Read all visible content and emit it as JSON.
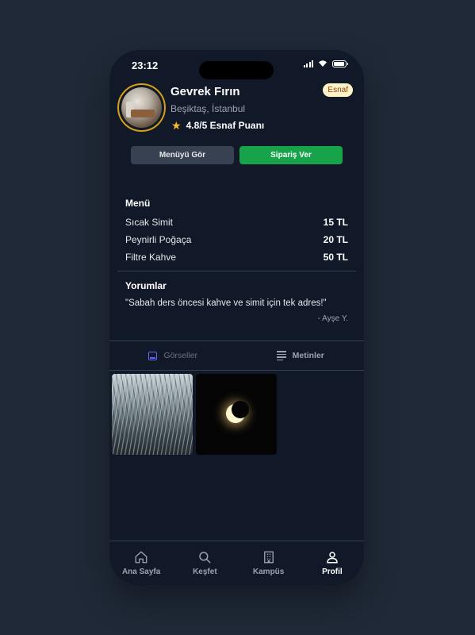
{
  "status": {
    "time": "23:12",
    "battery_level": 0.9
  },
  "shop": {
    "name": "Gevrek Fırın",
    "location": "Beşiktaş, İstanbul",
    "rating": "4.8/5 Esnaf Puanı",
    "badge": "Esnaf"
  },
  "actions": {
    "menu_button": "Menüyü Gör",
    "order_button": "Sipariş Ver"
  },
  "menu": {
    "title": "Menü",
    "items": [
      {
        "name": "Sıcak Simit",
        "price": "15 TL"
      },
      {
        "name": "Peynirli Poğaça",
        "price": "20 TL"
      },
      {
        "name": "Filtre Kahve",
        "price": "50 TL"
      }
    ]
  },
  "reviews": {
    "title": "Yorumlar",
    "quote": "\"Sabah ders öncesi kahve ve simit için tek adres!\"",
    "author": "- Ayşe Y."
  },
  "content_tabs": [
    {
      "label": "Görseller",
      "icon": "image-icon"
    },
    {
      "label": "Metinler",
      "icon": "text-lines-icon"
    }
  ],
  "bottom_nav": [
    {
      "label": "Ana Sayfa",
      "icon": "home-icon"
    },
    {
      "label": "Keşfet",
      "icon": "search-icon"
    },
    {
      "label": "Kampüs",
      "icon": "building-icon"
    },
    {
      "label": "Profil",
      "icon": "user-icon",
      "active": true
    }
  ],
  "colors": {
    "background": "#1f2937",
    "surface": "#111827",
    "primary_green": "#16a34a",
    "accent_gold": "#d4a017",
    "tab_active": "#6366f1"
  }
}
